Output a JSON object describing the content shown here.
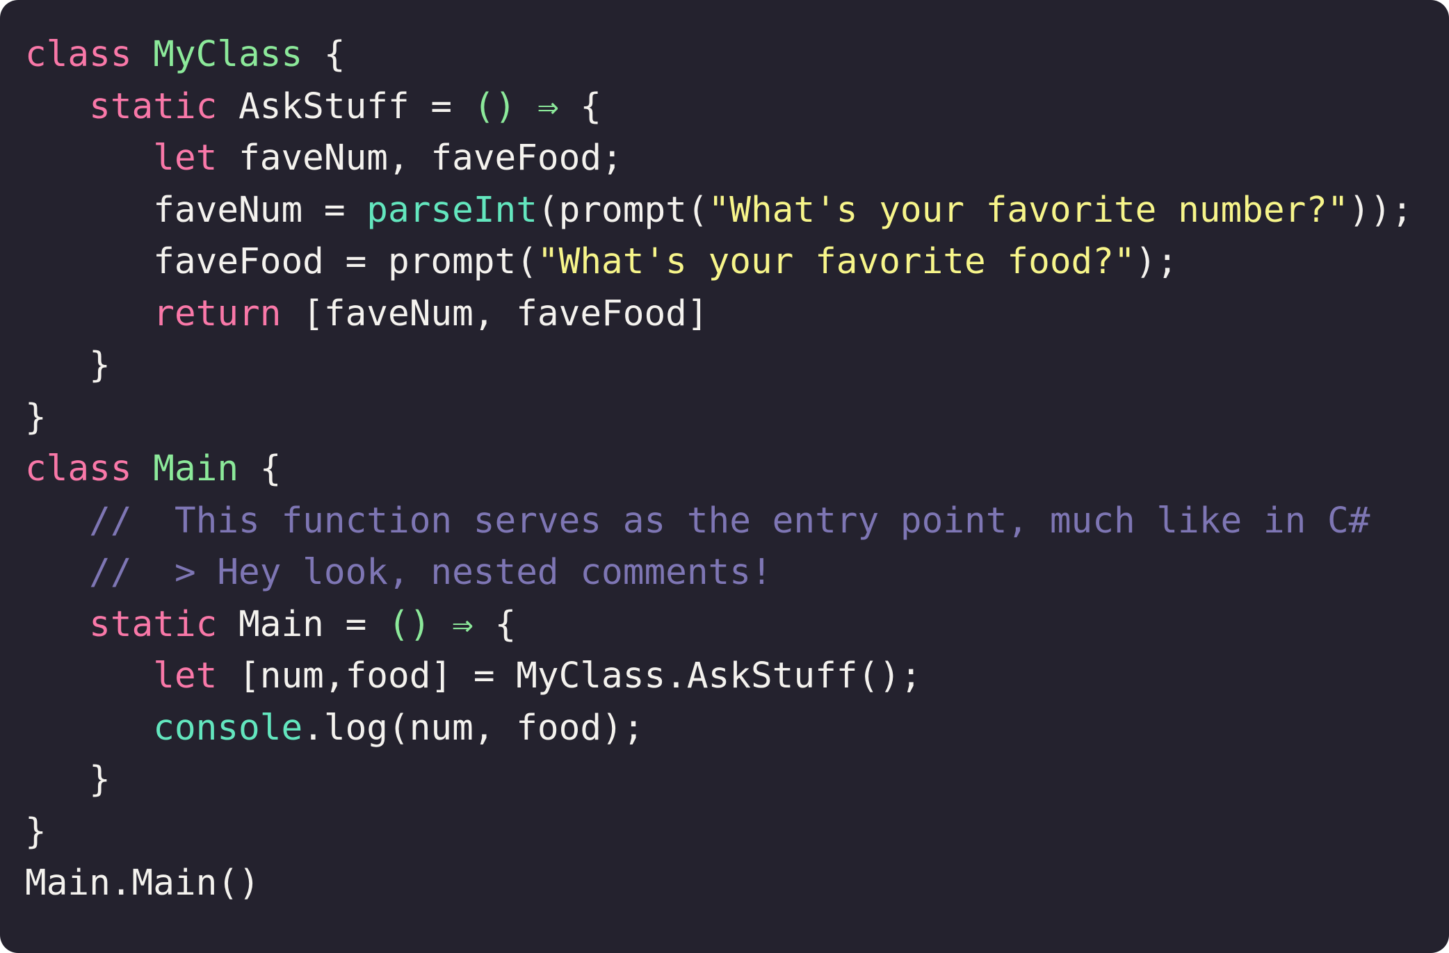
{
  "card": {
    "background_color": "#24222e",
    "corner_radius_px": 26,
    "language": "javascript"
  },
  "palette": {
    "background": "#24222e",
    "foreground": "#f4f2ee",
    "keyword": "#f978a8",
    "class_name": "#8ce99a",
    "builtin": "#63e6be",
    "string": "#f7f58a",
    "comment": "#7e76b4",
    "arrow": "#8ce99a",
    "paren_green": "#8ce99a"
  },
  "code": {
    "full_text": "class MyClass {\n   static AskStuff = () ⇒ {\n      let faveNum, faveFood;\n      faveNum = parseInt(prompt(\"What's your favorite number?\"));\n      faveFood = prompt(\"What's your favorite food?\");\n      return [faveNum, faveFood]\n   }\n}\nclass Main {\n   //  This function serves as the entry point, much like in C#\n   //  > Hey look, nested comments!\n   static Main = () ⇒ {\n      let [num,food] = MyClass.AskStuff();\n      console.log(num, food);\n   }\n}\nMain.Main()",
    "lines": [
      {
        "index": 1,
        "tokens": [
          {
            "text": "class",
            "kind": "keyword"
          },
          {
            "text": " ",
            "kind": "plain"
          },
          {
            "text": "MyClass",
            "kind": "class_name"
          },
          {
            "text": " {",
            "kind": "plain"
          }
        ]
      },
      {
        "index": 2,
        "tokens": [
          {
            "text": "   ",
            "kind": "plain"
          },
          {
            "text": "static",
            "kind": "keyword"
          },
          {
            "text": " AskStuff = ",
            "kind": "plain"
          },
          {
            "text": "()",
            "kind": "paren_green"
          },
          {
            "text": " ",
            "kind": "plain"
          },
          {
            "text": "⇒",
            "kind": "arrow"
          },
          {
            "text": " {",
            "kind": "plain"
          }
        ]
      },
      {
        "index": 3,
        "tokens": [
          {
            "text": "      ",
            "kind": "plain"
          },
          {
            "text": "let",
            "kind": "keyword"
          },
          {
            "text": " faveNum, faveFood;",
            "kind": "plain"
          }
        ]
      },
      {
        "index": 4,
        "tokens": [
          {
            "text": "      faveNum = ",
            "kind": "plain"
          },
          {
            "text": "parseInt",
            "kind": "builtin"
          },
          {
            "text": "(prompt(",
            "kind": "plain"
          },
          {
            "text": "\"What's your favorite number?\"",
            "kind": "string"
          },
          {
            "text": "));",
            "kind": "plain"
          }
        ]
      },
      {
        "index": 5,
        "tokens": [
          {
            "text": "      faveFood = prompt(",
            "kind": "plain"
          },
          {
            "text": "\"What's your favorite food?\"",
            "kind": "string"
          },
          {
            "text": ");",
            "kind": "plain"
          }
        ]
      },
      {
        "index": 6,
        "tokens": [
          {
            "text": "      ",
            "kind": "plain"
          },
          {
            "text": "return",
            "kind": "keyword"
          },
          {
            "text": " [faveNum, faveFood]",
            "kind": "plain"
          }
        ]
      },
      {
        "index": 7,
        "tokens": [
          {
            "text": "   }",
            "kind": "plain"
          }
        ]
      },
      {
        "index": 8,
        "tokens": [
          {
            "text": "}",
            "kind": "plain"
          }
        ]
      },
      {
        "index": 9,
        "tokens": [
          {
            "text": "class",
            "kind": "keyword"
          },
          {
            "text": " ",
            "kind": "plain"
          },
          {
            "text": "Main",
            "kind": "class_name"
          },
          {
            "text": " {",
            "kind": "plain"
          }
        ]
      },
      {
        "index": 10,
        "tokens": [
          {
            "text": "   ",
            "kind": "plain"
          },
          {
            "text": "//  This function serves as the entry point, much like in C#",
            "kind": "comment"
          }
        ]
      },
      {
        "index": 11,
        "tokens": [
          {
            "text": "   ",
            "kind": "plain"
          },
          {
            "text": "//  > Hey look, nested comments!",
            "kind": "comment"
          }
        ]
      },
      {
        "index": 12,
        "tokens": [
          {
            "text": "   ",
            "kind": "plain"
          },
          {
            "text": "static",
            "kind": "keyword"
          },
          {
            "text": " Main = ",
            "kind": "plain"
          },
          {
            "text": "()",
            "kind": "paren_green"
          },
          {
            "text": " ",
            "kind": "plain"
          },
          {
            "text": "⇒",
            "kind": "arrow"
          },
          {
            "text": " {",
            "kind": "plain"
          }
        ]
      },
      {
        "index": 13,
        "tokens": [
          {
            "text": "      ",
            "kind": "plain"
          },
          {
            "text": "let",
            "kind": "keyword"
          },
          {
            "text": " [num,food] = MyClass.AskStuff();",
            "kind": "plain"
          }
        ]
      },
      {
        "index": 14,
        "tokens": [
          {
            "text": "      ",
            "kind": "plain"
          },
          {
            "text": "console",
            "kind": "builtin"
          },
          {
            "text": ".log(num, food);",
            "kind": "plain"
          }
        ]
      },
      {
        "index": 15,
        "tokens": [
          {
            "text": "   }",
            "kind": "plain"
          }
        ]
      },
      {
        "index": 16,
        "tokens": [
          {
            "text": "}",
            "kind": "plain"
          }
        ]
      },
      {
        "index": 17,
        "tokens": [
          {
            "text": "Main.Main()",
            "kind": "plain"
          }
        ]
      }
    ]
  }
}
